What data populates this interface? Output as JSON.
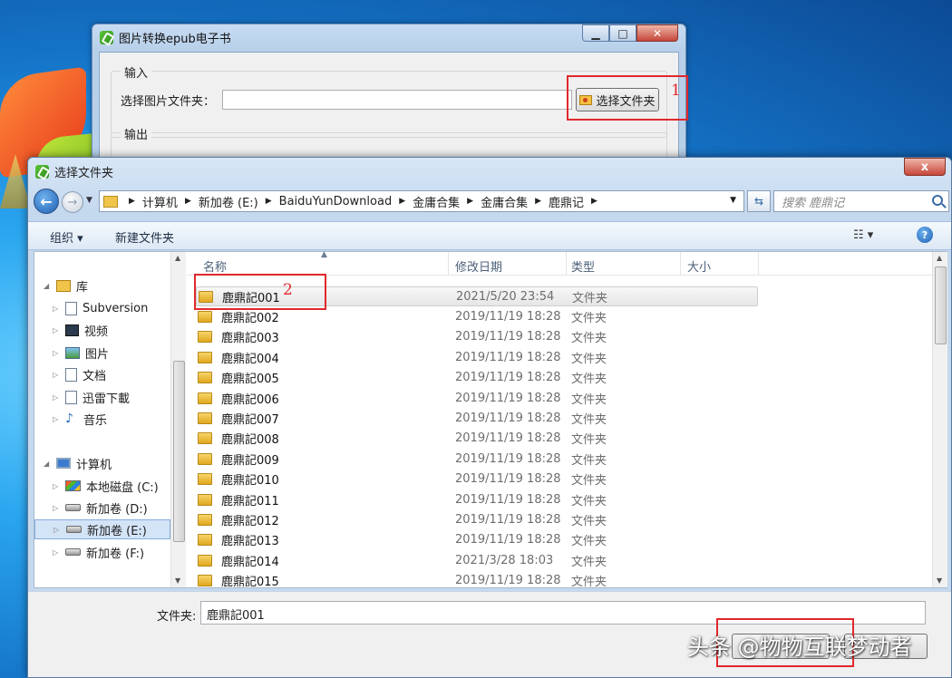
{
  "back_window": {
    "title": "图片转换epub电子书",
    "input_group": "输入",
    "folder_label": "选择图片文件夹：",
    "folder_value": "",
    "pick_button": "选择文件夹",
    "output_group": "输出",
    "min_icon": "minimize-icon",
    "max_icon": "maximize-icon",
    "close_icon": "close-icon"
  },
  "annotations": {
    "one": "1",
    "two": "2",
    "color": "#e0282c"
  },
  "dialog": {
    "title": "选择文件夹",
    "close_glyph": "x",
    "breadcrumb": [
      "计算机",
      "新加卷 (E:)",
      "BaiduYunDownload",
      "金庸合集",
      "金庸合集",
      "鹿鼎记"
    ],
    "search_placeholder": "搜索 鹿鼎记",
    "toolbar": {
      "organize": "组织 ▾",
      "new_folder": "新建文件夹"
    },
    "nav": {
      "libraries": "库",
      "library_items": [
        "Subversion",
        "视频",
        "图片",
        "文档",
        "迅雷下載",
        "音乐"
      ],
      "computer": "计算机",
      "drives": [
        "本地磁盘 (C:)",
        "新加卷 (D:)",
        "新加卷 (E:)",
        "新加卷 (F:)"
      ],
      "selected_drive": "新加卷 (E:)"
    },
    "columns": {
      "name": "名称",
      "date": "修改日期",
      "type": "类型",
      "size": "大小"
    },
    "files": [
      {
        "name": "鹿鼎記001",
        "date": "2021/5/20 23:54",
        "type": "文件夹"
      },
      {
        "name": "鹿鼎記002",
        "date": "2019/11/19 18:28",
        "type": "文件夹"
      },
      {
        "name": "鹿鼎記003",
        "date": "2019/11/19 18:28",
        "type": "文件夹"
      },
      {
        "name": "鹿鼎記004",
        "date": "2019/11/19 18:28",
        "type": "文件夹"
      },
      {
        "name": "鹿鼎記005",
        "date": "2019/11/19 18:28",
        "type": "文件夹"
      },
      {
        "name": "鹿鼎記006",
        "date": "2019/11/19 18:28",
        "type": "文件夹"
      },
      {
        "name": "鹿鼎記007",
        "date": "2019/11/19 18:28",
        "type": "文件夹"
      },
      {
        "name": "鹿鼎記008",
        "date": "2019/11/19 18:28",
        "type": "文件夹"
      },
      {
        "name": "鹿鼎記009",
        "date": "2019/11/19 18:28",
        "type": "文件夹"
      },
      {
        "name": "鹿鼎記010",
        "date": "2019/11/19 18:28",
        "type": "文件夹"
      },
      {
        "name": "鹿鼎記011",
        "date": "2019/11/19 18:28",
        "type": "文件夹"
      },
      {
        "name": "鹿鼎記012",
        "date": "2019/11/19 18:28",
        "type": "文件夹"
      },
      {
        "name": "鹿鼎記013",
        "date": "2019/11/19 18:28",
        "type": "文件夹"
      },
      {
        "name": "鹿鼎記014",
        "date": "2021/3/28 18:03",
        "type": "文件夹"
      },
      {
        "name": "鹿鼎記015",
        "date": "2019/11/19 18:28",
        "type": "文件夹"
      }
    ],
    "selected_file": "鹿鼎記001",
    "folder_label": "文件夹:",
    "folder_value": "鹿鼎記001"
  },
  "watermark": "头条 @物物互联梦动者"
}
